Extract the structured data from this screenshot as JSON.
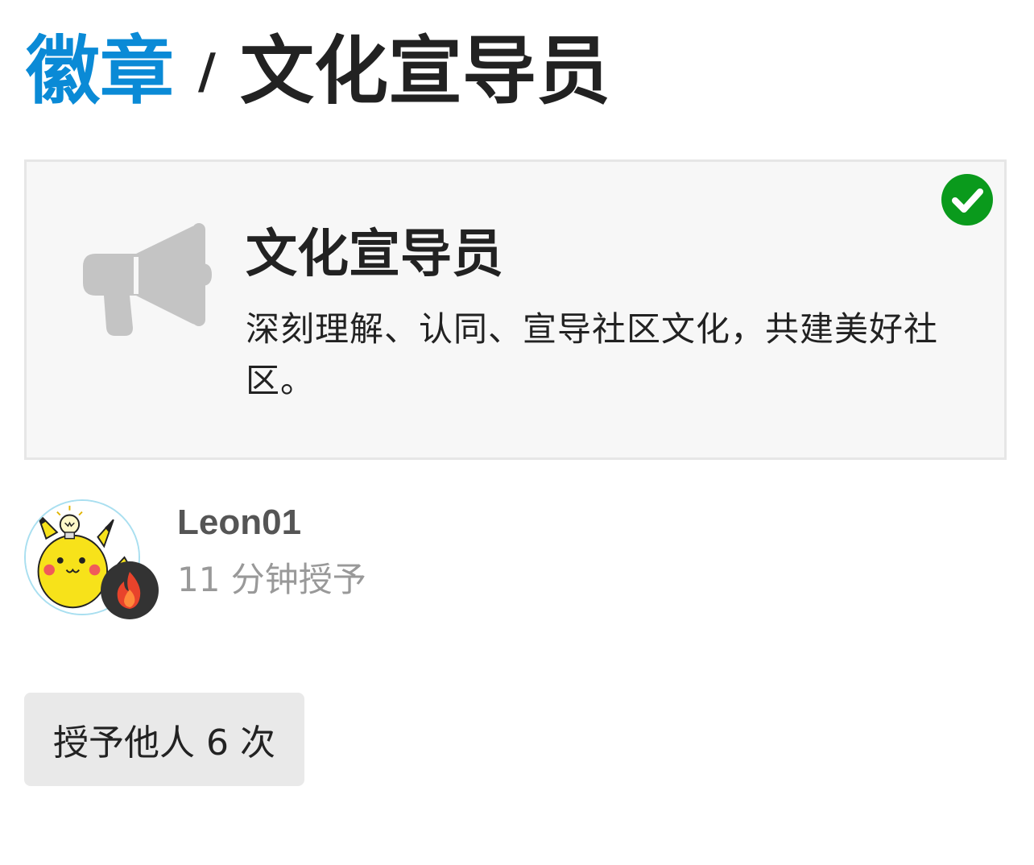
{
  "header": {
    "breadcrumb_root": "徽章",
    "separator": "/",
    "current": "文化宣导员"
  },
  "badge": {
    "name": "文化宣导员",
    "description": "深刻理解、认同、宣导社区文化，共建美好社区。",
    "icon": "bullhorn-icon",
    "granted_icon": "check-circle-icon",
    "colors": {
      "icon": "#c4c4c4",
      "check": "#0a9a1c",
      "card_bg": "#f7f7f7"
    }
  },
  "grant": {
    "username": "Leon01",
    "granted_time": "11 分钟授予",
    "avatar_icon": "pikachu-avatar",
    "flair_icon": "fire-icon"
  },
  "actions": {
    "grant_others_label": "授予他人 6 次"
  },
  "colors": {
    "link": "#0a8ad6",
    "text": "#222222",
    "muted": "#999999"
  }
}
